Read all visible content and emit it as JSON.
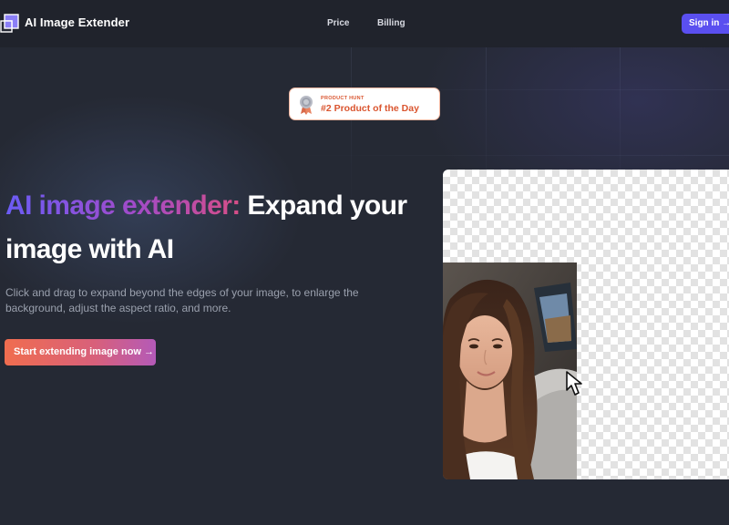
{
  "header": {
    "brand": "AI Image Extender",
    "nav": [
      {
        "label": "Price"
      },
      {
        "label": "Billing"
      }
    ],
    "signin_label": "Sign in →"
  },
  "badge": {
    "small_text": "PRODUCT HUNT",
    "big_text": "#2 Product of the Day"
  },
  "hero": {
    "title_highlight": "AI image extender:",
    "title_rest": " Expand your image with AI",
    "subtitle": "Click and drag to expand beyond the edges of your image, to enlarge the background, adjust the aspect ratio, and more.",
    "cta_label": "Start extending image now →"
  },
  "icons": {
    "logo": "overlapping-squares-icon",
    "medal": "medal-icon",
    "cursor": "arrow-cursor-icon"
  },
  "colors": {
    "background": "#252934",
    "header": "#20232c",
    "accent": "#5a4ff0",
    "product_hunt": "#da552f"
  }
}
